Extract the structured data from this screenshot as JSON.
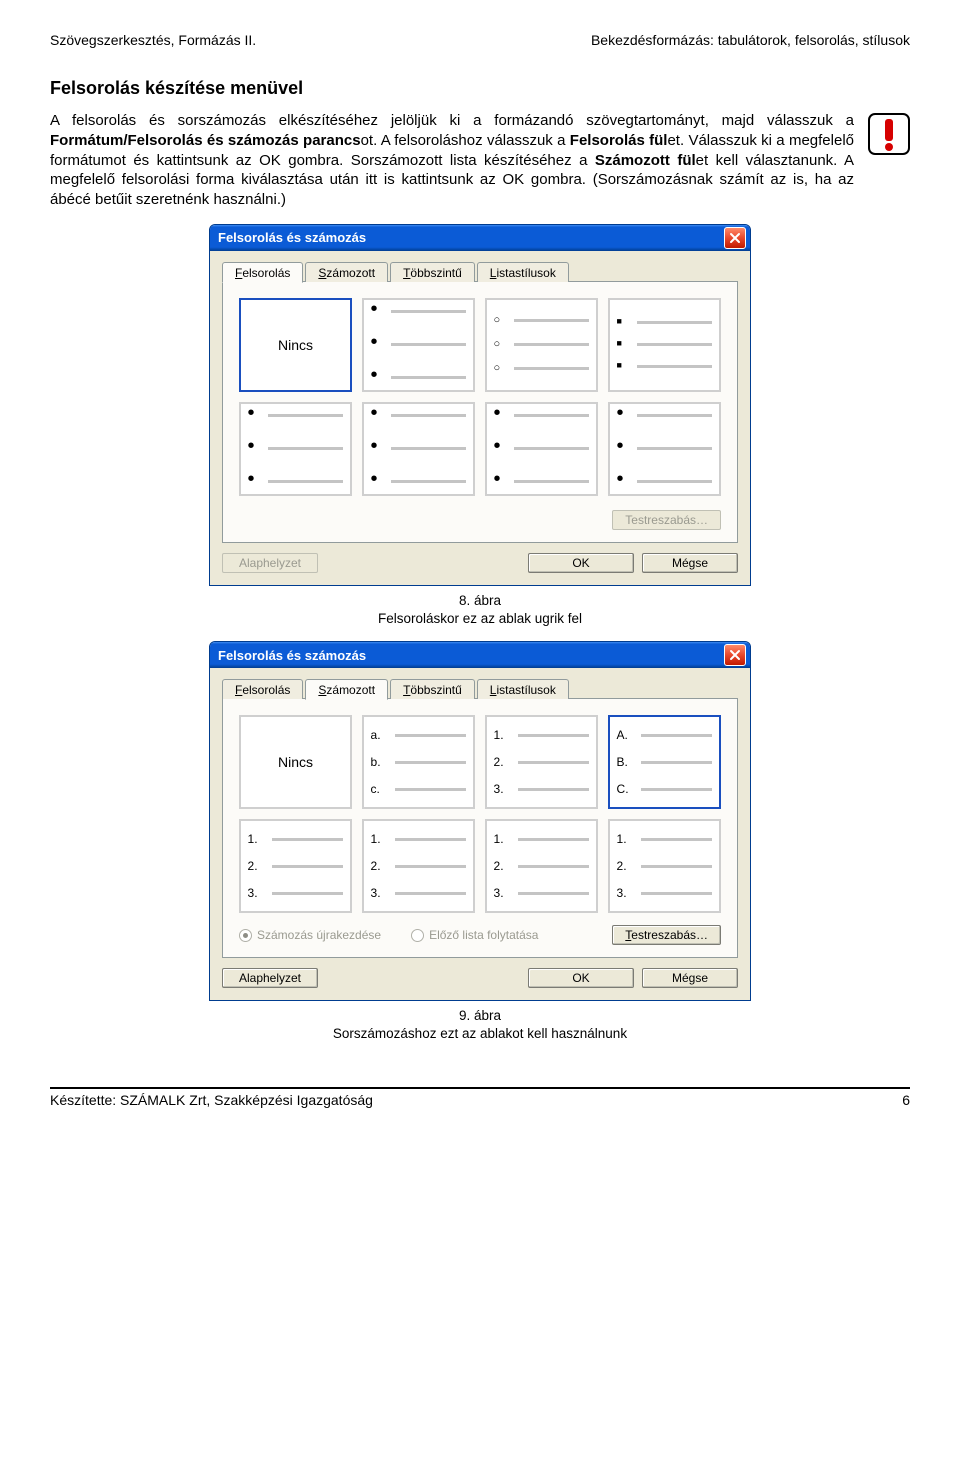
{
  "header": {
    "left": "Szövegszerkesztés, Formázás II.",
    "right": "Bekezdésformázás: tabulátorok, felsorolás, stílusok"
  },
  "section_title": "Felsorolás készítése menüvel",
  "paragraph": {
    "p1_a": "A felsorolás és sorszámozás elkészítéséhez jelöljük ki a formázandó szövegtartományt, majd válasszuk a ",
    "p1_b": "Formátum/Felsorolás és számozás parancs",
    "p1_c": "ot. A felsoroláshoz válasszuk a ",
    "p1_d": "Felsorolás fül",
    "p1_e": "et. Válasszuk ki a megfelelő formátumot és kattintsunk az OK gombra. Sorszámozott lista készítéséhez a ",
    "p1_f": "Számozott fül",
    "p1_g": "et kell választanunk. A megfelelő felsorolási forma kiválasztása után itt is kattintsunk az OK gombra. (Sorszámozásnak számít az is, ha az ábécé betűit szeretnénk használni.)"
  },
  "dialog": {
    "title": "Felsorolás és számozás",
    "tabs": {
      "t1": "Felsorolás",
      "t2": "Számozott",
      "t3": "Többszintű",
      "t4": "Listastílusok",
      "u1": "F",
      "u2": "S",
      "u3": "T",
      "u4": "L"
    },
    "none_label": "Nincs",
    "customize": "Testreszabás…",
    "reset": "Alaphelyzet",
    "ok": "OK",
    "cancel": "Mégse",
    "radio1": "Számozás újrakezdése",
    "radio2": "Előző lista folytatása"
  },
  "numbered_sets": {
    "r1": [
      [
        "",
        "",
        ""
      ],
      [
        "a.",
        "b.",
        "c."
      ],
      [
        "1.",
        "2.",
        "3."
      ],
      [
        "A.",
        "B.",
        "C."
      ]
    ],
    "r2": [
      [
        "1.",
        "2.",
        "3."
      ],
      [
        "1.",
        "2.",
        "3."
      ],
      [
        "1.",
        "2.",
        "3."
      ],
      [
        "1.",
        "2.",
        "3."
      ]
    ]
  },
  "caption1_a": "8. ábra",
  "caption1_b": "Felsoroláskor ez az ablak ugrik fel",
  "caption2_a": "9. ábra",
  "caption2_b": "Sorszámozáshoz ezt az ablakot kell használnunk",
  "footer": {
    "left": "Készítette: SZÁMALK Zrt, Szakképzési Igazgatóság",
    "right": "6"
  }
}
